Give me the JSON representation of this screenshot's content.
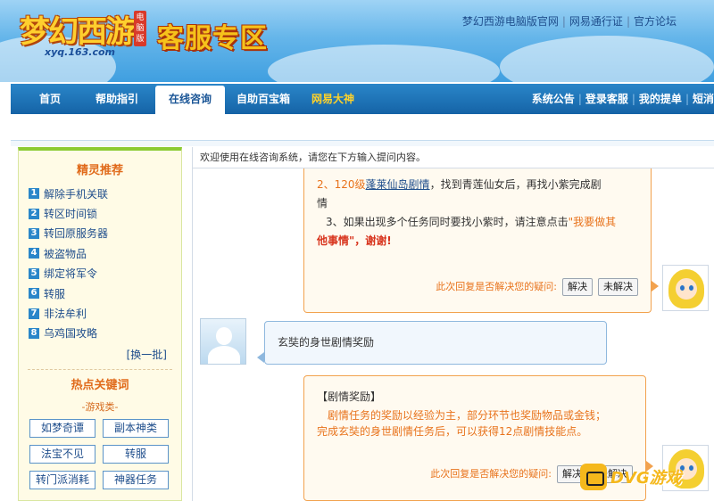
{
  "header": {
    "logo_main": "梦幻西游",
    "logo_badge": "电脑版",
    "logo_url": "xyq.163.com",
    "site_title": "客服专区",
    "top_links": [
      "梦幻西游电脑版官网",
      "网易通行证",
      "官方论坛"
    ]
  },
  "nav": {
    "tabs": [
      "首页",
      "帮助指引",
      "在线咨询",
      "自助百宝箱",
      "网易大神"
    ],
    "active_tab": "在线咨询",
    "right_links": [
      "系统公告",
      "登录客服",
      "我的提单",
      "短消"
    ]
  },
  "sidebar": {
    "recommend_title": "精灵推荐",
    "items": [
      {
        "num": "1",
        "label": "解除手机关联"
      },
      {
        "num": "2",
        "label": "转区时间锁"
      },
      {
        "num": "3",
        "label": "转回原服务器"
      },
      {
        "num": "4",
        "label": "被盗物品"
      },
      {
        "num": "5",
        "label": "绑定将军令"
      },
      {
        "num": "6",
        "label": "转服"
      },
      {
        "num": "7",
        "label": "非法牟利"
      },
      {
        "num": "8",
        "label": "乌鸡国攻略"
      }
    ],
    "refresh": "[换一批]",
    "hot_title": "热点关键词",
    "category": "-游戏类-",
    "keywords": [
      "如梦奇谭",
      "副本神类",
      "法宝不见",
      "转服",
      "转门派消耗",
      "神器任务"
    ]
  },
  "chat": {
    "welcome": "欢迎使用在线咨询系统，请您在下方输入提问内容。",
    "msg1": {
      "line2_prefix": "2、120级",
      "line2_link": "蓬莱仙岛剧情",
      "line2_suffix": "，找到青莲仙女后，再找小紫完成剧",
      "line2_cont": "情",
      "line3_prefix": "3、如果出现多个任务同时要找小紫时，请注意点击",
      "line3_highlight": "\"我要做其",
      "line3_highlight2": "他事情\"，谢谢!",
      "vote_prompt": "此次回复是否解决您的疑问:",
      "solved": "解决",
      "unsolved": "未解决"
    },
    "user_msg": "玄奘的身世剧情奖励",
    "msg2": {
      "heading": "【剧情奖励】",
      "line1": "剧情任务的奖励以经验为主，部分环节也奖励物品或金钱；",
      "line2": "完成玄奘的身世剧情任务后，可以获得12点剧情技能点。",
      "vote_prompt": "此次回复是否解决您的疑问:",
      "solved": "解决",
      "unsolved": "未解决"
    }
  },
  "watermark": "DVG游戏"
}
